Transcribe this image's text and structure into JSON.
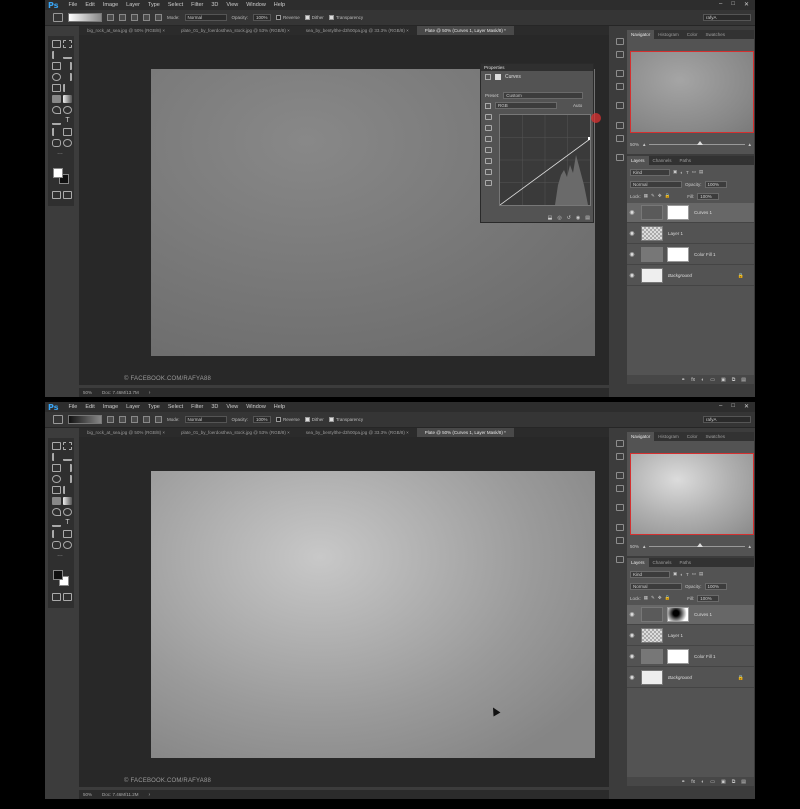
{
  "app": {
    "logo": "Ps",
    "menu": [
      "File",
      "Edit",
      "Image",
      "Layer",
      "Type",
      "Select",
      "Filter",
      "3D",
      "View",
      "Window",
      "Help"
    ],
    "window_controls": [
      "–",
      "□",
      "✕"
    ]
  },
  "options_bar": {
    "mode_label": "Mode:",
    "mode_value": "Normal",
    "opacity_label": "Opacity:",
    "opacity_value": "100%",
    "reverse_label": "Reverse",
    "dither_label": "Dither",
    "transparency_label": "Transparency",
    "workspace_value": "rafyA"
  },
  "tabs": [
    {
      "label": "big_rock_at_sea.jpg @ 50% (RGB/8) ×",
      "active": false
    },
    {
      "label": "plate_01_by_foerdosthea_stock.jpg @ 53% (RGB/8) ×",
      "active": false
    },
    {
      "label": "sea_by_bentylthe-d3h00pa.jpg @ 33.3% (RGB/8) ×",
      "active": false
    },
    {
      "label": "Plate @ 50% (Curves 1, Layer Mask/8) *",
      "active": true
    }
  ],
  "watermark": "© FACEBOOK.COM/RAFYA88",
  "status": {
    "zoom": "50%",
    "doc_size": "Doc: 7.46M/13.7M",
    "doc_size_2": "Doc: 7.46M/11.2M",
    "arrow": "›"
  },
  "navigator": {
    "tabs": [
      "Navigator",
      "Histogram",
      "Color",
      "Swatches"
    ],
    "zoom": "50%"
  },
  "layers_panel": {
    "tabs": [
      "Layers",
      "Channels",
      "Paths"
    ],
    "kind_label": "Kind",
    "blend_mode": "Normal",
    "opacity_label": "Opacity:",
    "opacity_value": "100%",
    "lock_label": "Lock:",
    "fill_label": "Fill:",
    "fill_value": "100%",
    "layers": [
      {
        "name": "Curves 1",
        "selected": true,
        "type": "adjustment"
      },
      {
        "name": "Layer 1",
        "selected": false,
        "type": "transparent"
      },
      {
        "name": "Color Fill 1",
        "selected": false,
        "type": "fill"
      },
      {
        "name": "Background",
        "selected": false,
        "type": "background"
      }
    ],
    "footer_icons": [
      "fx",
      "◐",
      "▭",
      "▣",
      "⧉",
      "🗑"
    ]
  },
  "properties": {
    "header": "Properties",
    "title": "Curves",
    "preset_label": "Preset:",
    "preset_value": "Custom",
    "channel_value": "RGB",
    "auto_label": "Auto"
  },
  "colors": {
    "accent_red": "#d43030",
    "ps_blue": "#39a6f7"
  }
}
